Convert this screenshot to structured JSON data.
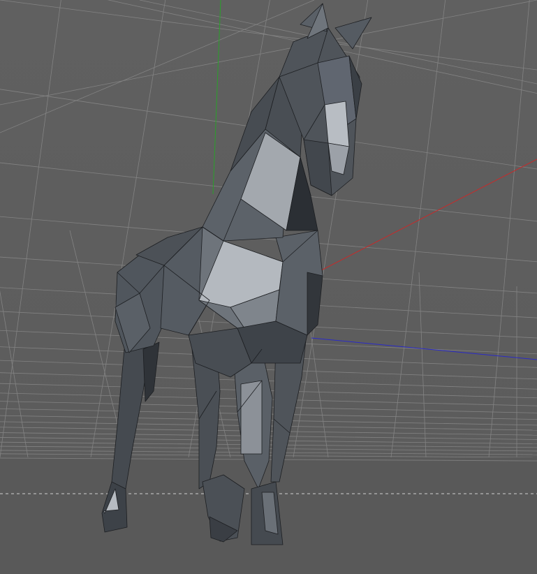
{
  "viewport": {
    "view": "perspective-3d",
    "background_color": "#5e5e5e",
    "floor_color": "#5a5a5a",
    "grid_color": "#8a8a8a",
    "horizon_marker_color": "#d0d0d0",
    "axis_x_color": "#c82a2a",
    "axis_y_color": "#2aa02a",
    "axis_z_color": "#2a2ac8"
  },
  "model": {
    "type": "low-poly horse mesh",
    "shading": "flat",
    "edges_visible": true,
    "base_color": "#4d5258",
    "light_color": "#a9aeb4",
    "dark_color": "#2e3237",
    "edge_color": "#1a1c1f"
  }
}
